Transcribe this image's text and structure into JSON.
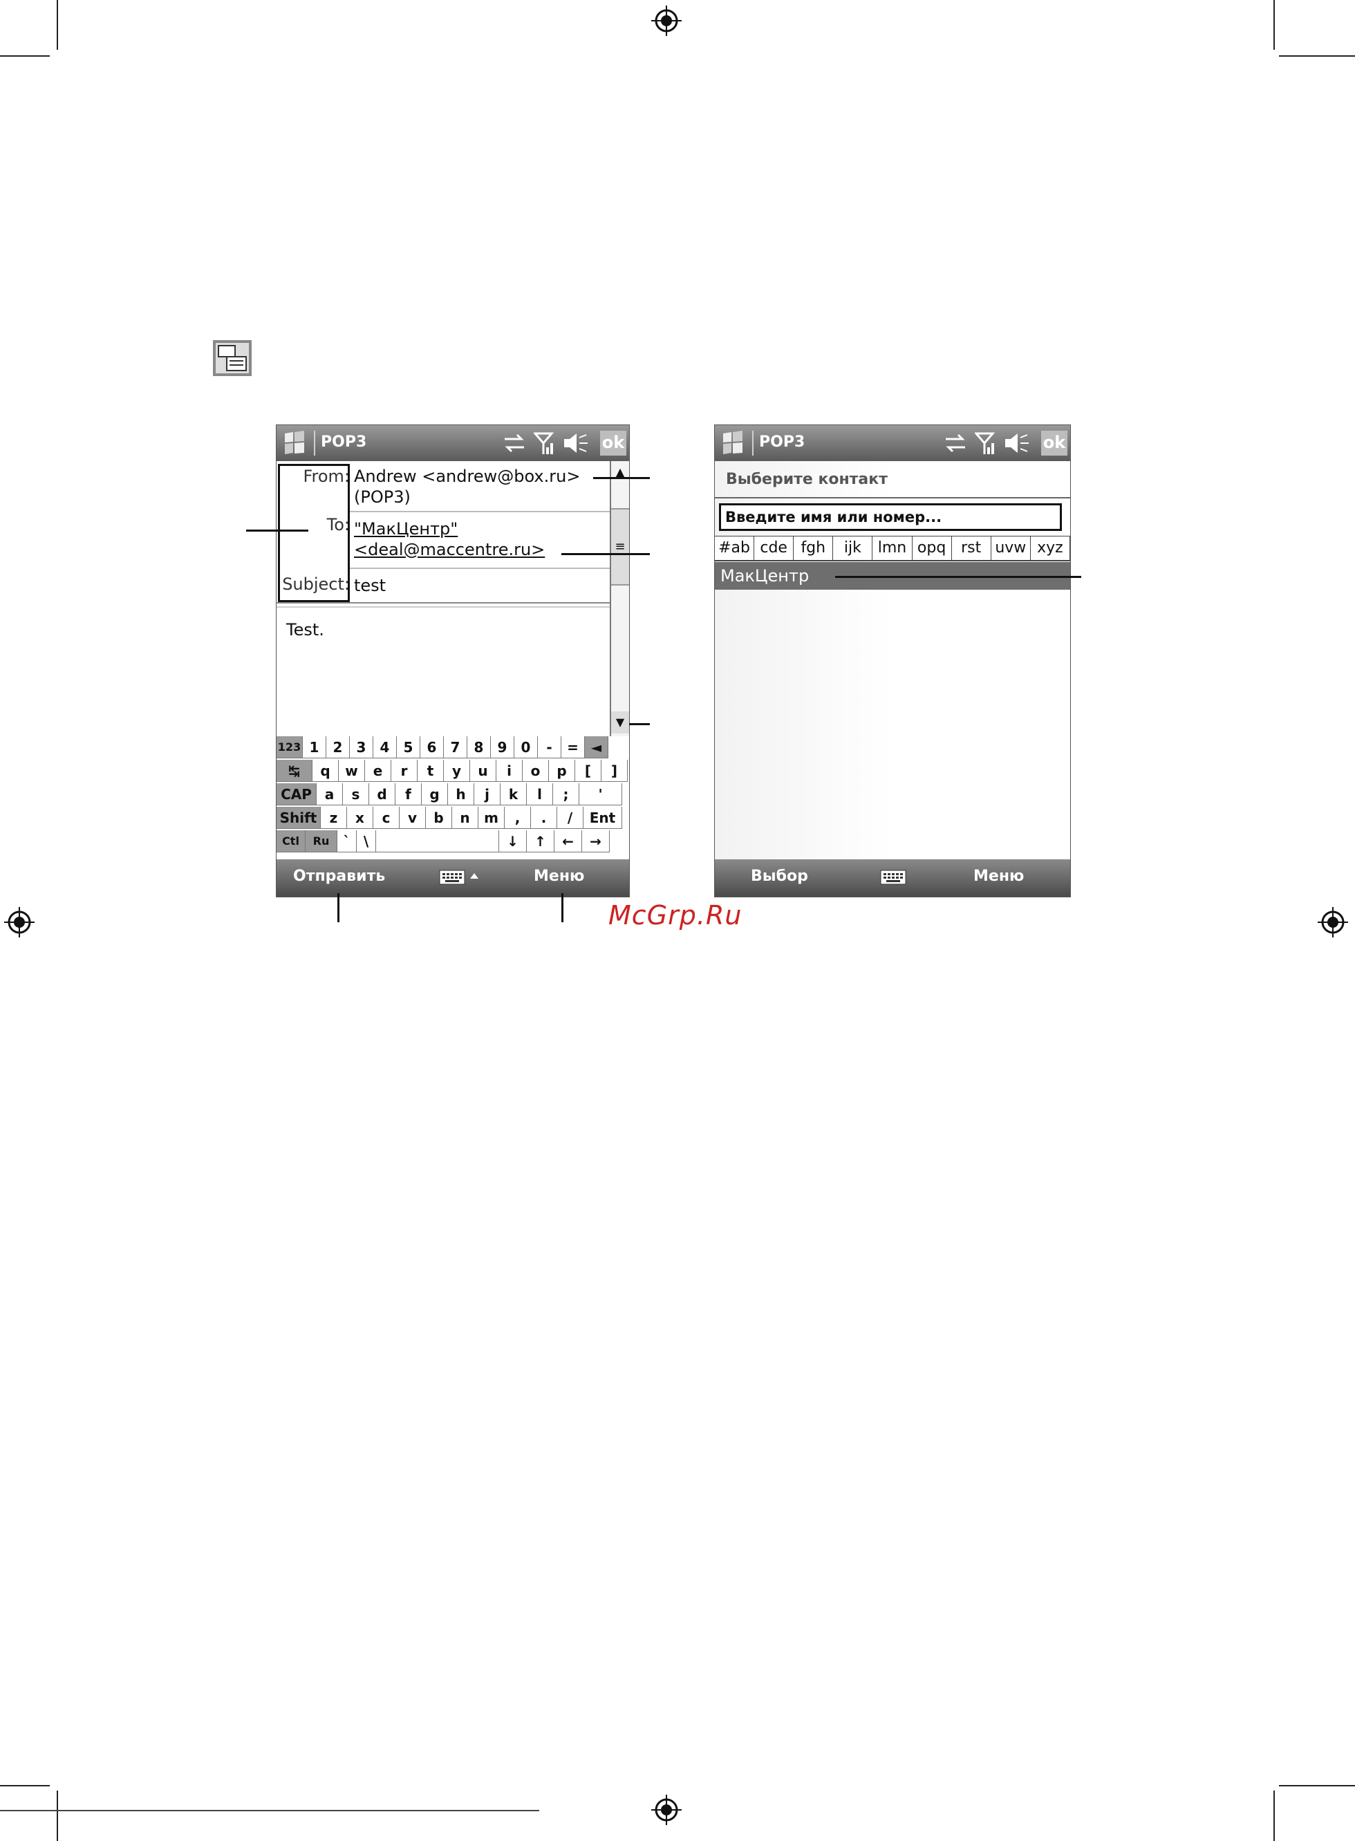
{
  "left_screen": {
    "title": "POP3",
    "ok_label": "ok",
    "from_label": "From:",
    "from_value": "Andrew <andrew@box.ru>",
    "from_value2": "(POP3)",
    "to_label": "To:",
    "to_value": "\"МакЦентр\"",
    "to_value2": "<deal@maccentre.ru>",
    "subject_label": "Subject:",
    "subject_value": "test",
    "body_text": "Test.",
    "keyboard": {
      "row1": [
        "123",
        "1",
        "2",
        "3",
        "4",
        "5",
        "6",
        "7",
        "8",
        "9",
        "0",
        "-",
        "=",
        "◄"
      ],
      "row2": [
        "↹",
        "q",
        "w",
        "e",
        "r",
        "t",
        "y",
        "u",
        "i",
        "o",
        "p",
        "[",
        "]"
      ],
      "row3": [
        "CAP",
        "a",
        "s",
        "d",
        "f",
        "g",
        "h",
        "j",
        "k",
        "l",
        ";",
        "'"
      ],
      "row4": [
        "Shift",
        "z",
        "x",
        "c",
        "v",
        "b",
        "n",
        "m",
        ",",
        ".",
        "/",
        "Ent"
      ],
      "row5": [
        "Ctl",
        "Ru",
        "`",
        "\\",
        "",
        "↓",
        "↑",
        "←",
        "→"
      ]
    },
    "softkey_left": "Отправить",
    "softkey_right": "Меню"
  },
  "right_screen": {
    "title": "POP3",
    "ok_label": "ok",
    "prompt": "Выберите контакт",
    "search_placeholder": "Введите имя или номер...",
    "abc_tabs": [
      "#ab",
      "cde",
      "fgh",
      "ijk",
      "lmn",
      "opq",
      "rst",
      "uvw",
      "xyz"
    ],
    "contact": "МакЦентр",
    "softkey_left": "Выбор",
    "softkey_right": "Меню"
  },
  "watermark": "McGrp.Ru",
  "accent_watermark_color": "#cc2222"
}
